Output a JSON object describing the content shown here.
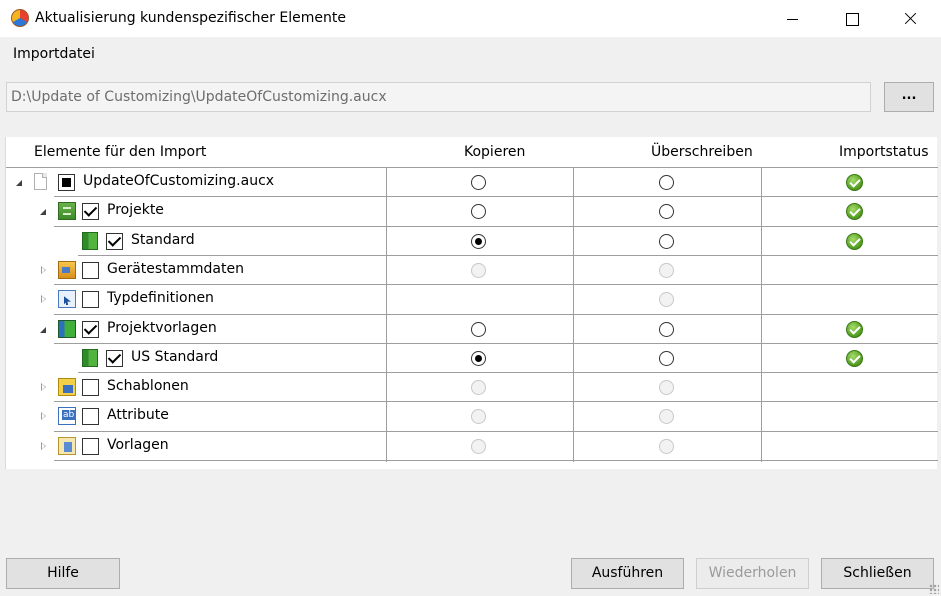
{
  "window": {
    "title": "Aktualisierung kundenspezifischer Elemente",
    "controls": [
      "minimize",
      "maximize",
      "close"
    ]
  },
  "import": {
    "label": "Importdatei",
    "path": "D:\\Update of Customizing\\UpdateOfCustomizing.aucx",
    "browse_label": "..."
  },
  "grid": {
    "columns": {
      "elements": "Elemente für den Import",
      "copy": "Kopieren",
      "overwrite": "Überschreiben",
      "status": "Importstatus"
    },
    "rows": [
      {
        "label": "UpdateOfCustomizing.aucx",
        "icon": "document-icon",
        "expander": "expanded",
        "check": "indeterminate",
        "copy": "off",
        "overwrite": "off",
        "status": "ok"
      },
      {
        "label": "Projekte",
        "icon": "projects-cabinet-icon",
        "expander": "expanded",
        "check": "checked",
        "copy": "off",
        "overwrite": "off",
        "status": "ok"
      },
      {
        "label": "Standard",
        "icon": "project-book-icon",
        "expander": "none",
        "check": "checked",
        "copy": "on",
        "overwrite": "off",
        "status": "ok"
      },
      {
        "label": "Gerätestammdaten",
        "icon": "device-masterdata-icon",
        "expander": "collapsed",
        "check": "unchecked",
        "copy": "disabled",
        "overwrite": "disabled",
        "status": "none"
      },
      {
        "label": "Typdefinitionen",
        "icon": "type-definitions-icon",
        "expander": "collapsed",
        "check": "unchecked",
        "copy": "hidden",
        "overwrite": "disabled",
        "status": "none"
      },
      {
        "label": "Projektvorlagen",
        "icon": "project-templates-icon",
        "expander": "expanded",
        "check": "checked",
        "copy": "off",
        "overwrite": "off",
        "status": "ok"
      },
      {
        "label": "US Standard",
        "icon": "project-book-icon",
        "expander": "none",
        "check": "checked",
        "copy": "on",
        "overwrite": "off",
        "status": "ok"
      },
      {
        "label": "Schablonen",
        "icon": "stencils-icon",
        "expander": "collapsed",
        "check": "unchecked",
        "copy": "disabled",
        "overwrite": "disabled",
        "status": "none"
      },
      {
        "label": "Attribute",
        "icon": "attributes-icon",
        "expander": "collapsed",
        "check": "unchecked",
        "copy": "disabled",
        "overwrite": "disabled",
        "status": "none"
      },
      {
        "label": "Vorlagen",
        "icon": "templates-icon",
        "expander": "collapsed",
        "check": "unchecked",
        "copy": "disabled",
        "overwrite": "disabled",
        "status": "none"
      }
    ]
  },
  "buttons": {
    "help": "Hilfe",
    "run": "Ausführen",
    "repeat": "Wiederholen",
    "close": "Schließen"
  }
}
